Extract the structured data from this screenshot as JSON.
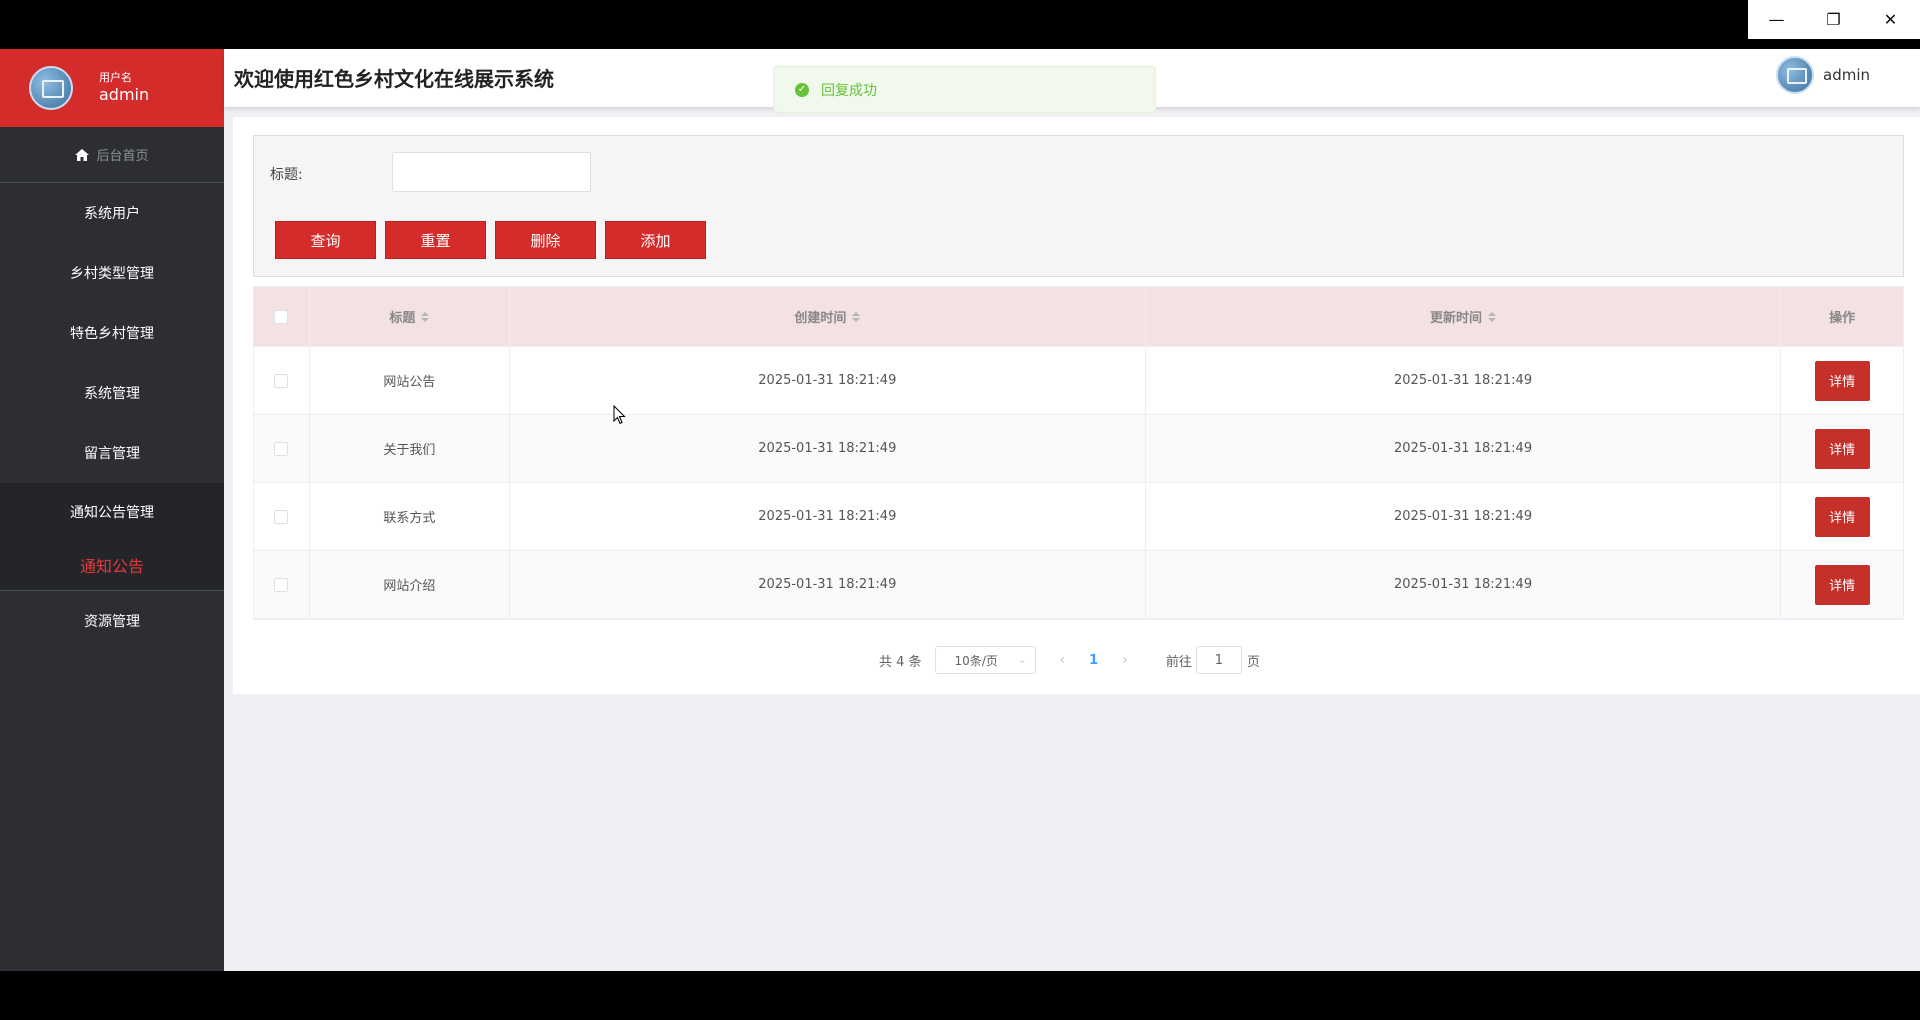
{
  "window": {
    "minimize_icon": "minimize-icon",
    "restore_icon": "restore-icon",
    "close_icon": "close-icon"
  },
  "sidebar": {
    "user_label": "用户名",
    "user_name": "admin",
    "home_label": "后台首页",
    "items": [
      {
        "label": "系统用户"
      },
      {
        "label": "乡村类型管理"
      },
      {
        "label": "特色乡村管理"
      },
      {
        "label": "系统管理"
      },
      {
        "label": "留言管理"
      },
      {
        "label": "通知公告管理"
      }
    ],
    "active_sub_item": "通知公告",
    "last_item": "资源管理"
  },
  "header": {
    "title": "欢迎使用红色乡村文化在线展示系统",
    "user_name": "admin"
  },
  "toast": {
    "message": "回复成功",
    "color": "#67c23a"
  },
  "search": {
    "title_label": "标题:",
    "title_value": "",
    "buttons": {
      "query": "查询",
      "reset": "重置",
      "delete": "删除",
      "add": "添加"
    }
  },
  "table": {
    "columns": {
      "title": "标题",
      "created": "创建时间",
      "updated": "更新时间",
      "actions": "操作"
    },
    "detail_label": "详情",
    "rows": [
      {
        "title": "网站公告",
        "created": "2025-01-31 18:21:49",
        "updated": "2025-01-31 18:21:49"
      },
      {
        "title": "关于我们",
        "created": "2025-01-31 18:21:49",
        "updated": "2025-01-31 18:21:49"
      },
      {
        "title": "联系方式",
        "created": "2025-01-31 18:21:49",
        "updated": "2025-01-31 18:21:49"
      },
      {
        "title": "网站介绍",
        "created": "2025-01-31 18:21:49",
        "updated": "2025-01-31 18:21:49"
      }
    ]
  },
  "pagination": {
    "total_text": "共 4 条",
    "page_size": "10条/页",
    "current_page": "1",
    "jump_prefix": "前往",
    "jump_value": "1",
    "jump_suffix": "页"
  },
  "colors": {
    "accent": "#d42b2b",
    "sidebar_bg": "#2c2e33",
    "table_header_bg": "#f3e1e4"
  }
}
